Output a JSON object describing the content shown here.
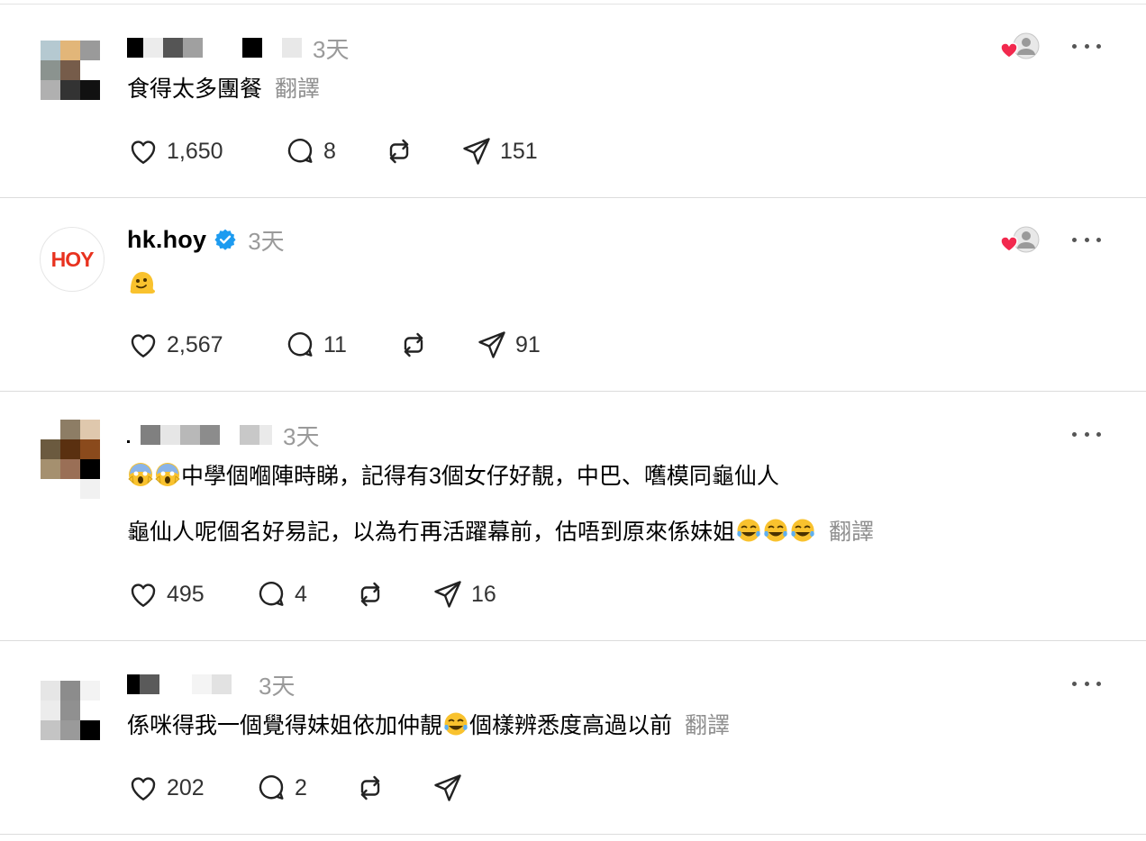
{
  "colors": {
    "like_red": "#f2294e",
    "verified_blue": "#1d9bf0",
    "hoy_red": "#e8321f",
    "muted": "#9a9a9a"
  },
  "posts": [
    {
      "author": "",
      "time": "3天",
      "text": "食得太多團餐",
      "translate": "翻譯",
      "likes": "1,650",
      "comments": "8",
      "reposts": "",
      "shares": "151"
    },
    {
      "author": "hk.hoy",
      "verified": true,
      "avatar_logo": "HOY",
      "time": "3天",
      "emoji": "melting-face-emoji",
      "likes": "2,567",
      "comments": "11",
      "reposts": "",
      "shares": "91"
    },
    {
      "author": "",
      "time": "3天",
      "text_line1": "中學個嗰陣時睇，記得有3個女仔好靚，中巴、嚿模同龜仙人",
      "text_line2": "龜仙人呢個名好易記，以為冇再活躍幕前，估唔到原來係妹姐",
      "translate": "翻譯",
      "likes": "495",
      "comments": "4",
      "reposts": "",
      "shares": "16"
    },
    {
      "author": "",
      "time": "3天",
      "text_part1": "係咪得我一個覺得妹姐依加仲靚",
      "text_part2": "個樣辨悉度高過以前",
      "translate": "翻譯",
      "likes": "202",
      "comments": "2",
      "reposts": "",
      "shares": ""
    }
  ]
}
